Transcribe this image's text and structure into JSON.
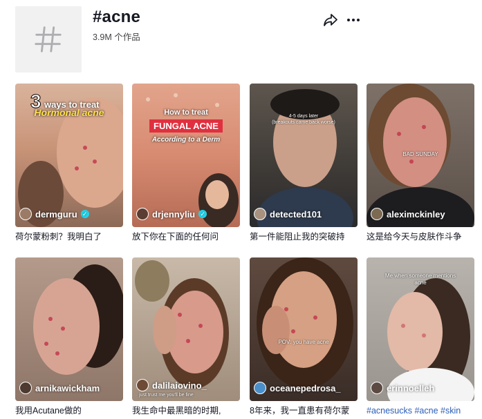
{
  "header": {
    "title": "#acne",
    "count": "3.9M 个作品"
  },
  "colors": {
    "accent": "#fe2c55",
    "verified": "#20d5ec",
    "hashtag": "#2b5db9"
  },
  "videos": [
    {
      "username": "dermguru",
      "verified": true,
      "caption": "荷尔蒙粉刺？我明白了",
      "overlay_line1": "3",
      "overlay_line1b": "ways to treat",
      "overlay_line2": "Hormonal acne"
    },
    {
      "username": "drjennyliu",
      "verified": true,
      "caption": "放下你在下面的任何问",
      "overlay_line1": "How to treat",
      "overlay_line2": "FUNGAL ACNE",
      "overlay_line3": "According to a Derm"
    },
    {
      "username": "detected101",
      "verified": false,
      "caption": "第一件能阻止我的突破持",
      "overlay_line1": "4-5 days later",
      "overlay_line2": "(breakouts came back worse)"
    },
    {
      "username": "aleximckinley",
      "verified": false,
      "caption": "这是给今天与皮肤作斗争",
      "overlay_line1": "BAD SUNDAY"
    },
    {
      "username": "arnikawickham",
      "verified": false,
      "caption": "我用Acutane做的"
    },
    {
      "username": "dalilaiovino_",
      "verified": false,
      "caption": "我生命中最黑暗的时期,",
      "overlay_line1": "just trust me you'll be fine"
    },
    {
      "username": "oceanepedrosa_",
      "verified": false,
      "caption": "8年来，我一直患有荷尔蒙",
      "overlay_line1": "POV: you have acne"
    },
    {
      "username": "erinnoelleh",
      "verified": false,
      "caption": "#acnesucks #acne #skin",
      "overlay_line1": "Me when someone mentions",
      "overlay_line2": "acne"
    }
  ]
}
